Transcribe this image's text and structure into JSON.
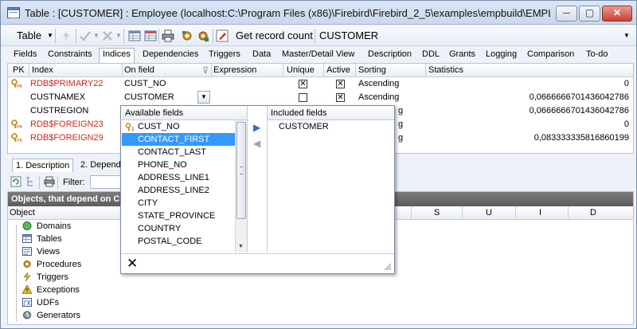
{
  "window": {
    "title": "Table : [CUSTOMER] : Employee (localhost:C:\\Program Files (x86)\\Firebird\\Firebird_2_5\\examples\\empbuild\\EMPL...",
    "min_glyph": "─",
    "max_glyph": "▢",
    "close_glyph": "✕"
  },
  "toolbar": {
    "table_label": "Table",
    "get_record_count_label": "Get record count",
    "table_name": "CUSTOMER"
  },
  "tabs": [
    {
      "label": "Fields"
    },
    {
      "label": "Constraints"
    },
    {
      "label": "Indices"
    },
    {
      "label": "Dependencies"
    },
    {
      "label": "Triggers"
    },
    {
      "label": "Data"
    },
    {
      "label": "Master/Detail View"
    },
    {
      "label": "Description"
    },
    {
      "label": "DDL"
    },
    {
      "label": "Grants"
    },
    {
      "label": "Logging"
    },
    {
      "label": "Comparison"
    },
    {
      "label": "To-do"
    }
  ],
  "grid": {
    "columns": {
      "pk": "PK",
      "index": "Index",
      "on_field": "On field",
      "expression": "Expression",
      "unique": "Unique",
      "active": "Active",
      "sorting": "Sorting",
      "statistics": "Statistics"
    },
    "rows": [
      {
        "index": "RDB$PRIMARY22",
        "on_field": "CUST_NO",
        "unique": true,
        "active": true,
        "sorting": "Ascending",
        "statistics": "0",
        "red": true,
        "key": true
      },
      {
        "index": "CUSTNAMEX",
        "on_field": "CUSTOMER",
        "unique": false,
        "active": true,
        "sorting": "Ascending",
        "statistics": "0,0666666701436042786",
        "red": false,
        "key": false
      },
      {
        "index": "CUSTREGION",
        "on_field": "",
        "unique": false,
        "active": false,
        "sorting": "g",
        "statistics": "0,0666666701436042786",
        "red": false,
        "key": false
      },
      {
        "index": "RDB$FOREIGN23",
        "on_field": "",
        "unique": false,
        "active": false,
        "sorting": "g",
        "statistics": "0",
        "red": true,
        "key": true
      },
      {
        "index": "RDB$FOREIGN29",
        "on_field": "",
        "unique": false,
        "active": false,
        "sorting": "g",
        "statistics": "0,083333335816860199",
        "red": true,
        "key": true
      }
    ]
  },
  "colors": {
    "red_index": "#d8231a",
    "selection": "#3399ff",
    "group_bar": "#6a6a6a"
  },
  "lower": {
    "subtab_description": "1. Description",
    "subtab_dependencies": "2. Depende",
    "filter_label": "Filter:",
    "group_title": "Objects, that depend on C",
    "col_object": "Object",
    "col_s": "S",
    "col_u": "U",
    "col_i": "I",
    "col_d": "D",
    "tree": [
      {
        "label": "Domains",
        "icon": "domain-icon"
      },
      {
        "label": "Tables",
        "icon": "table-icon"
      },
      {
        "label": "Views",
        "icon": "view-icon"
      },
      {
        "label": "Procedures",
        "icon": "procedure-icon"
      },
      {
        "label": "Triggers",
        "icon": "trigger-icon"
      },
      {
        "label": "Exceptions",
        "icon": "exception-icon"
      },
      {
        "label": "UDFs",
        "icon": "udf-icon"
      },
      {
        "label": "Generators",
        "icon": "generator-icon"
      }
    ]
  },
  "popup": {
    "available_header": "Available fields",
    "included_header": "Included fields",
    "available": [
      "CUST_NO",
      "CONTACT_FIRST",
      "CONTACT_LAST",
      "PHONE_NO",
      "ADDRESS_LINE1",
      "ADDRESS_LINE2",
      "CITY",
      "STATE_PROVINCE",
      "COUNTRY",
      "POSTAL_CODE"
    ],
    "selected_index": 1,
    "included": [
      "CUSTOMER"
    ],
    "move_right_glyph": "▶",
    "move_left_glyph": "◀",
    "cancel_glyph": "✕"
  }
}
